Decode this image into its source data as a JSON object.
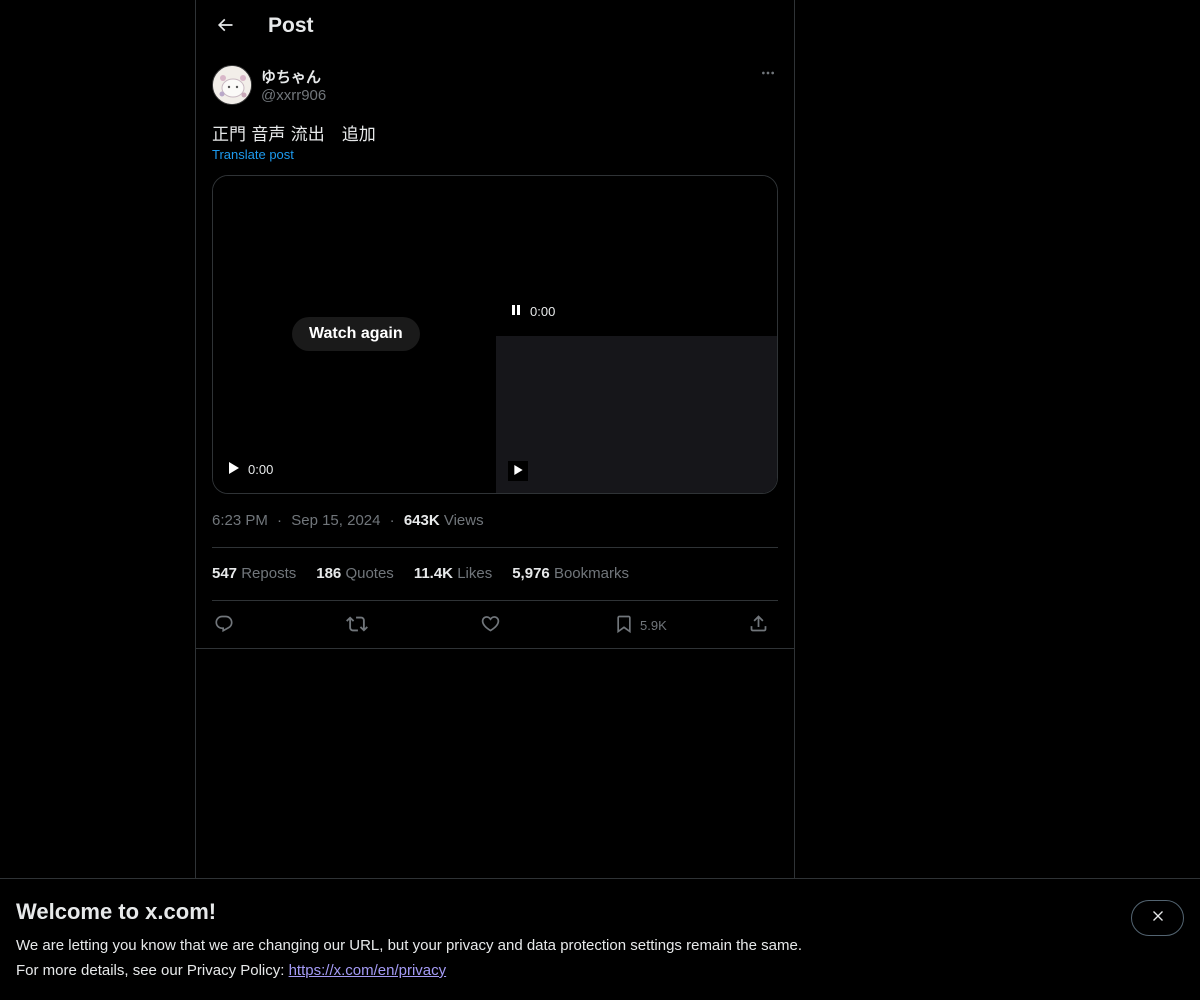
{
  "header": {
    "title": "Post"
  },
  "post": {
    "author_name": "ゆちゃん",
    "author_handle": "@xxrr906",
    "text": "正門 音声 流出　追加",
    "translate_label": "Translate post",
    "media": {
      "watch_again_label": "Watch again",
      "left_time": "0:00",
      "right_time": "0:00"
    },
    "meta": {
      "time": "6:23 PM",
      "sep": "·",
      "date": "Sep 15, 2024",
      "views_count": "643K",
      "views_label": "Views"
    },
    "stats": {
      "reposts_count": "547",
      "reposts_label": "Reposts",
      "quotes_count": "186",
      "quotes_label": "Quotes",
      "likes_count": "11.4K",
      "likes_label": "Likes",
      "bookmarks_count": "5,976",
      "bookmarks_label": "Bookmarks"
    },
    "actions": {
      "bookmark_count": "5.9K",
      "icons": [
        "reply-icon",
        "repost-icon",
        "like-icon",
        "bookmark-icon",
        "share-icon"
      ]
    }
  },
  "banner": {
    "title": "Welcome to x.com!",
    "line1": "We are letting you know that we are changing our URL, but your privacy and data protection settings remain the same.",
    "line2_prefix": "For more details, see our Privacy Policy: ",
    "line2_link": "https://x.com/en/privacy"
  },
  "colors": {
    "background": "#000000",
    "text": "#e7e9ea",
    "muted": "#71767b",
    "accent": "#1d9bf0",
    "link": "#a49bf5",
    "border": "#2f3336"
  }
}
